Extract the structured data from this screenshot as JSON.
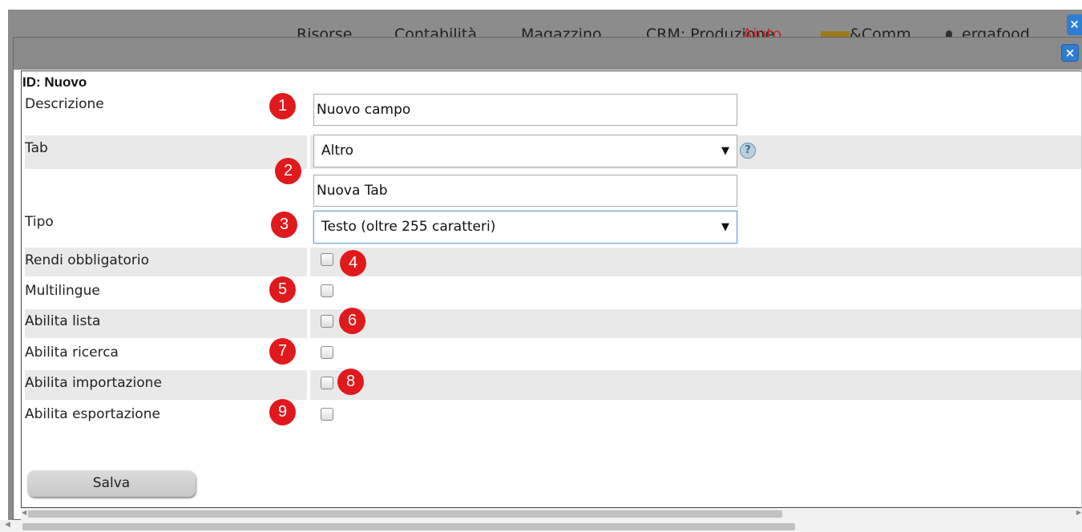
{
  "background": {
    "nav_items": [
      "Risorse",
      "Contabilità",
      "Magazzino",
      "CRM: Produzione",
      "Aiuto",
      "&Comm",
      "ergafood"
    ],
    "close_glyph": "×"
  },
  "dialog": {
    "close_glyph": "×",
    "id_title": "ID: Nuovo",
    "fields": {
      "descrizione": {
        "label": "Descrizione",
        "value": "Nuovo campo"
      },
      "tab": {
        "label": "Tab",
        "selected": "Altro",
        "new_tab_value": "Nuova Tab",
        "help_glyph": "?"
      },
      "tipo": {
        "label": "Tipo",
        "selected": "Testo (oltre 255 caratteri)"
      },
      "rendi_obbligatorio": {
        "label": "Rendi obbligatorio",
        "checked": false
      },
      "multilingue": {
        "label": "Multilingue",
        "checked": false
      },
      "abilita_lista": {
        "label": "Abilita lista",
        "checked": false
      },
      "abilita_ricerca": {
        "label": "Abilita ricerca",
        "checked": false
      },
      "abilita_importazione": {
        "label": "Abilita importazione",
        "checked": false
      },
      "abilita_esportazione": {
        "label": "Abilita esportazione",
        "checked": false
      }
    },
    "save_label": "Salva",
    "caret_glyph": "▼"
  },
  "annotations": [
    "1",
    "2",
    "3",
    "4",
    "5",
    "6",
    "7",
    "8",
    "9"
  ],
  "colors": {
    "badge": "#e0191c",
    "close_button": "#2d7ed3",
    "row_shade": "#e9e9e9",
    "titlebar": "#8a8a8a"
  }
}
